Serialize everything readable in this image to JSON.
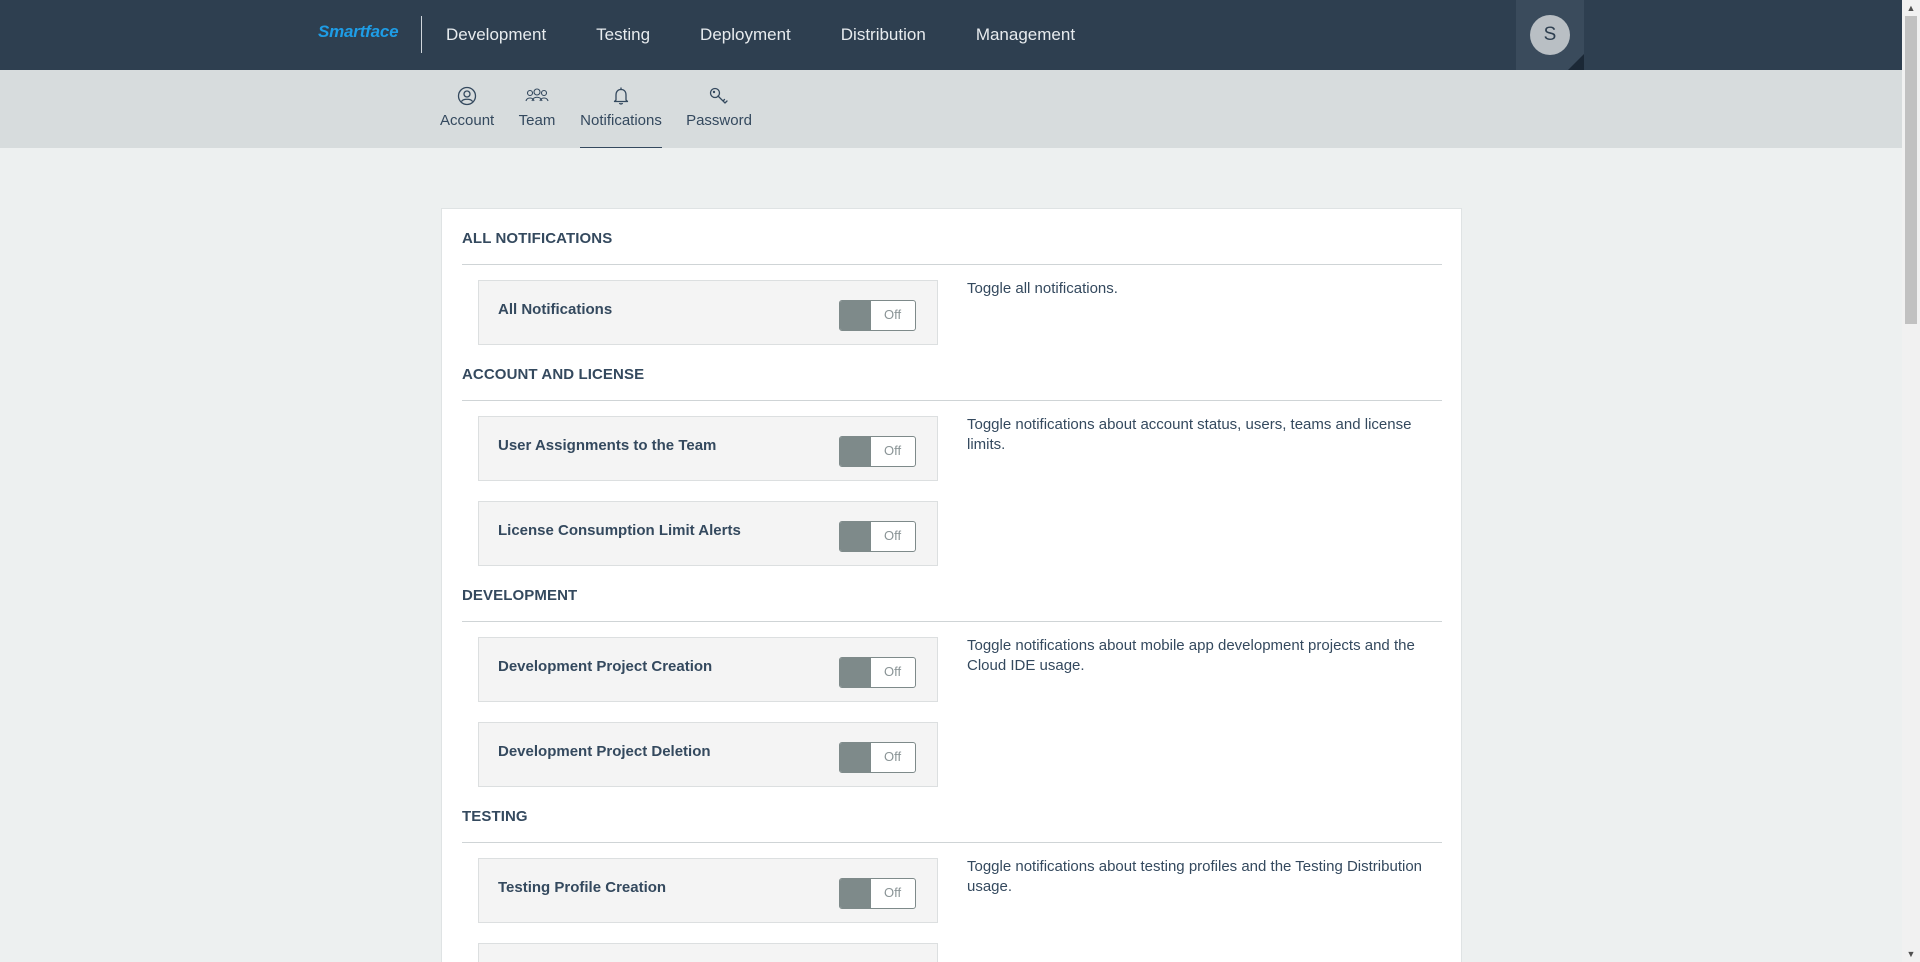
{
  "header": {
    "logo": "Smartface",
    "nav": [
      "Development",
      "Testing",
      "Deployment",
      "Distribution",
      "Management"
    ],
    "avatar_initial": "S"
  },
  "subnav": {
    "items": [
      {
        "label": "Account",
        "icon": "user-circle-icon"
      },
      {
        "label": "Team",
        "icon": "team-icon"
      },
      {
        "label": "Notifications",
        "icon": "bell-icon"
      },
      {
        "label": "Password",
        "icon": "key-icon"
      }
    ],
    "active": "Notifications"
  },
  "sections": [
    {
      "title": "ALL NOTIFICATIONS",
      "description": "Toggle all notifications.",
      "rows": [
        {
          "label": "All Notifications",
          "state": "Off"
        }
      ]
    },
    {
      "title": "ACCOUNT AND LICENSE",
      "description": "Toggle notifications about account status, users, teams and license limits.",
      "rows": [
        {
          "label": "User Assignments to the Team",
          "state": "Off"
        },
        {
          "label": "License Consumption Limit Alerts",
          "state": "Off"
        }
      ]
    },
    {
      "title": "DEVELOPMENT",
      "description": "Toggle notifications about mobile app development projects and the Cloud IDE usage.",
      "rows": [
        {
          "label": "Development Project Creation",
          "state": "Off"
        },
        {
          "label": "Development Project Deletion",
          "state": "Off"
        }
      ]
    },
    {
      "title": "TESTING",
      "description": "Toggle notifications about testing profiles and the Testing Distribution usage.",
      "rows": [
        {
          "label": "Testing Profile Creation",
          "state": "Off"
        }
      ]
    }
  ],
  "colors": {
    "topbar": "#2e3f50",
    "brand": "#1e9de6",
    "subbar": "#d7dcdd",
    "toggle_off": "#7e8a8a"
  }
}
